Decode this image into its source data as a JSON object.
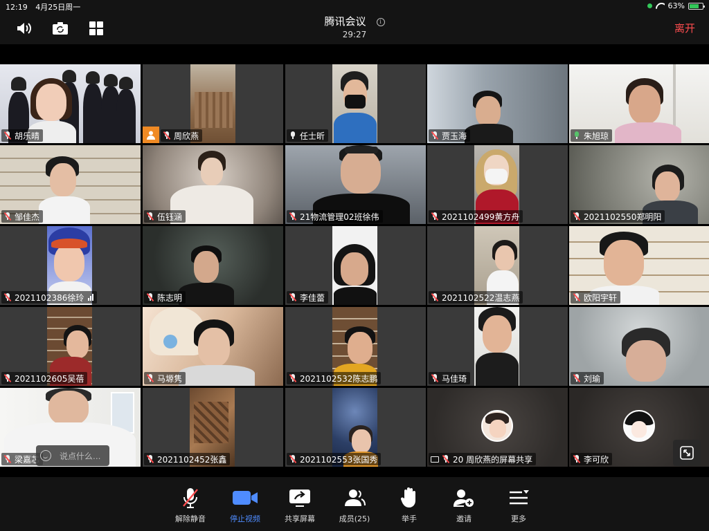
{
  "status_bar": {
    "time": "12:19",
    "date": "4月25日周一",
    "battery": "63%",
    "battery_level": 0.63,
    "colors": {
      "recording_dot": "#33c759",
      "battery_fill": "#33c759"
    }
  },
  "header": {
    "title": "腾讯会议",
    "duration": "29:27",
    "leave_label": "离开",
    "icons": [
      "speaker-icon",
      "camera-switch-icon",
      "grid-layout-icon",
      "info-icon"
    ],
    "colors": {
      "leave": "#ff4d4f"
    }
  },
  "participants": [
    {
      "name": "胡乐晴",
      "mic": "muted"
    },
    {
      "name": "周欣燕",
      "mic": "muted"
    },
    {
      "name": "任士昕",
      "mic": "unmuted"
    },
    {
      "name": "贾玉海",
      "mic": "muted"
    },
    {
      "name": "朱旭琼",
      "mic": "speaking"
    },
    {
      "name": "邹佳杰",
      "mic": "muted"
    },
    {
      "name": "伍钰涵",
      "mic": "muted"
    },
    {
      "name": "21物流管理02班徐伟",
      "mic": "muted"
    },
    {
      "name": "2021102499黄方舟",
      "mic": "muted"
    },
    {
      "name": "2021102550郑明阳",
      "mic": "muted"
    },
    {
      "name": "2021102386徐玲",
      "mic": "muted"
    },
    {
      "name": "陈志明",
      "mic": "muted"
    },
    {
      "name": "李佳蕾",
      "mic": "muted"
    },
    {
      "name": "2021102522温志燕",
      "mic": "muted"
    },
    {
      "name": "欧阳宇轩",
      "mic": "muted"
    },
    {
      "name": "2021102605吴蓓",
      "mic": "muted"
    },
    {
      "name": "马塬隽",
      "mic": "muted"
    },
    {
      "name": "2021102532陈志鹏",
      "mic": "muted"
    },
    {
      "name": "马佳琦",
      "mic": "muted"
    },
    {
      "name": "刘瑜",
      "mic": "muted"
    },
    {
      "name": "梁嘉芯",
      "mic": "muted"
    },
    {
      "name": "2021102452张鑫",
      "mic": "muted"
    },
    {
      "name": "2021102553张国秀",
      "mic": "muted"
    },
    {
      "name": "20 周欣燕的屏幕共享",
      "mic": "muted"
    },
    {
      "name": "李可欣",
      "mic": "muted"
    }
  ],
  "chat_input": {
    "placeholder": "说点什么..."
  },
  "toolbar": {
    "unmute": "解除静音",
    "stop_video": "停止视频",
    "share_screen": "共享屏幕",
    "members": "成员(25)",
    "raise_hand": "举手",
    "invite": "邀请",
    "more": "更多",
    "colors": {
      "accent": "#4f8cff"
    }
  },
  "colors": {
    "active_speaker": "#57c26a",
    "muted_mic": "#ff4d4f"
  }
}
